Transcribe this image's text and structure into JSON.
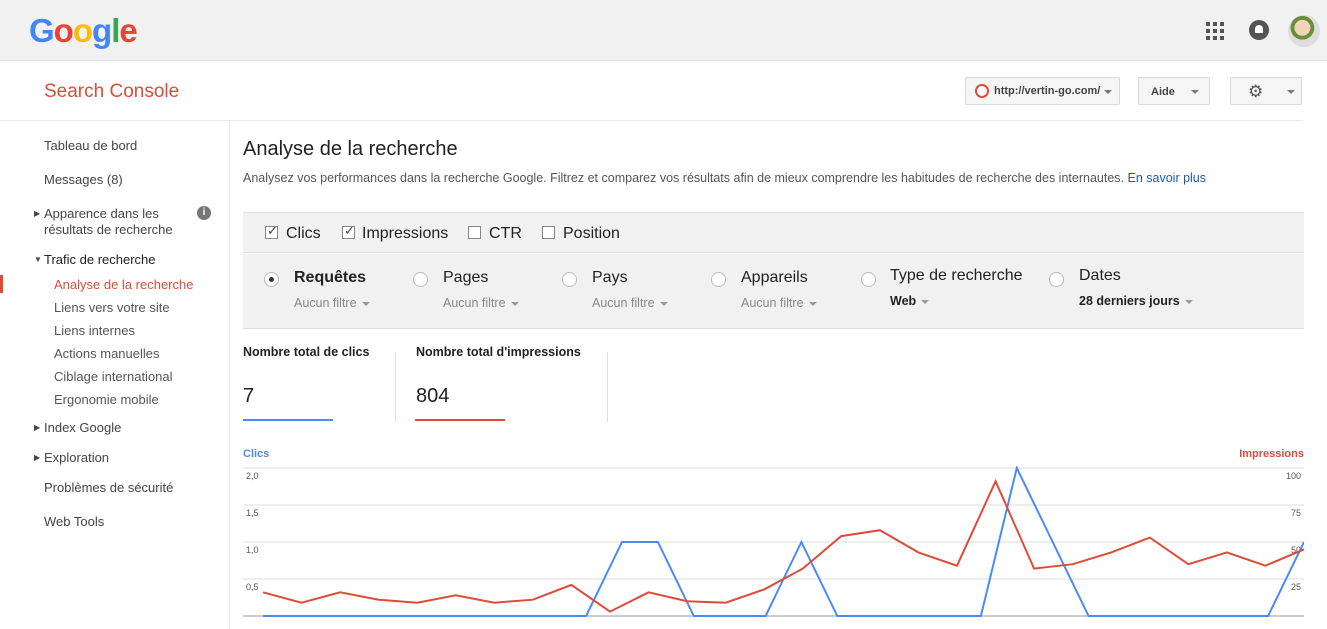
{
  "google_bar": {
    "logo_letters": [
      {
        "ch": "G",
        "color": "#4285f4"
      },
      {
        "ch": "o",
        "color": "#ea4335"
      },
      {
        "ch": "o",
        "color": "#fbbc05"
      },
      {
        "ch": "g",
        "color": "#4285f4"
      },
      {
        "ch": "l",
        "color": "#34a853"
      },
      {
        "ch": "e",
        "color": "#ea4335"
      }
    ],
    "icons": [
      "apps-icon",
      "notifications-icon",
      "avatar"
    ]
  },
  "header": {
    "title": "Search Console",
    "site": "http://vertin-go.com/",
    "help_label": "Aide",
    "settings_icon": "gear-icon"
  },
  "sidebar": {
    "items": [
      {
        "label": "Tableau de bord"
      },
      {
        "label": "Messages (8)"
      },
      {
        "label": "Apparence dans les résultats de recherche",
        "line1": "Apparence dans les",
        "line2": "résultats de recherche"
      },
      {
        "label": "Trafic de recherche"
      },
      {
        "label": "Index Google"
      },
      {
        "label": "Exploration"
      },
      {
        "label": "Problèmes de sécurité"
      },
      {
        "label": "Web Tools"
      }
    ],
    "sub_items": [
      {
        "label": "Analyse de la recherche",
        "active": true
      },
      {
        "label": "Liens vers votre site"
      },
      {
        "label": "Liens internes"
      },
      {
        "label": "Actions manuelles"
      },
      {
        "label": "Ciblage international"
      },
      {
        "label": "Ergonomie mobile"
      }
    ],
    "info_glyph": "i"
  },
  "main": {
    "title": "Analyse de la recherche",
    "description": "Analysez vos performances dans la recherche Google. Filtrez et comparez vos résultats afin de mieux comprendre les habitudes de recherche des internautes.",
    "learn_more": "En savoir plus",
    "metrics": [
      {
        "label": "Clics",
        "checked": true
      },
      {
        "label": "Impressions",
        "checked": true
      },
      {
        "label": "CTR",
        "checked": false
      },
      {
        "label": "Position",
        "checked": false
      }
    ],
    "filters": [
      {
        "label": "Requêtes",
        "selected": true,
        "sub": "Aucun filtre"
      },
      {
        "label": "Pages",
        "selected": false,
        "sub": "Aucun filtre"
      },
      {
        "label": "Pays",
        "selected": false,
        "sub": "Aucun filtre"
      },
      {
        "label": "Appareils",
        "selected": false,
        "sub": "Aucun filtre"
      },
      {
        "label": "Type de recherche",
        "selected": false,
        "sub": "Web"
      },
      {
        "label": "Dates",
        "selected": false,
        "sub": "28 derniers jours"
      }
    ],
    "totals": [
      {
        "label": "Nombre total de clics",
        "value": "7",
        "color": "#4a8af4"
      },
      {
        "label": "Nombre total d'impressions",
        "value": "804",
        "color": "#dd4b39"
      }
    ]
  },
  "chart_data": {
    "type": "line",
    "left_axis_title": "Clics",
    "right_axis_title": "Impressions",
    "left_ticks": [
      "2,0",
      "1,5",
      "1,0",
      "0,5"
    ],
    "right_ticks": [
      "100",
      "75",
      "50",
      "25"
    ],
    "left_ylim": [
      0,
      2
    ],
    "right_ylim": [
      0,
      100
    ],
    "series": [
      {
        "name": "Clics",
        "axis": "left",
        "color": "#4a8af4",
        "values": [
          0,
          0,
          0,
          0,
          0,
          0,
          0,
          0,
          0,
          0,
          1,
          1,
          0,
          0,
          0,
          1,
          0,
          0,
          0,
          0,
          0,
          2,
          1,
          0,
          0,
          0,
          0,
          0,
          0,
          1
        ]
      },
      {
        "name": "Impressions",
        "axis": "right",
        "color": "#dd4b39",
        "values": [
          16,
          9,
          16,
          11,
          9,
          14,
          9,
          11,
          21,
          3,
          16,
          10,
          9,
          18,
          32,
          54,
          58,
          43,
          34,
          91,
          32,
          35,
          43,
          53,
          35,
          43,
          34,
          45
        ]
      }
    ]
  }
}
